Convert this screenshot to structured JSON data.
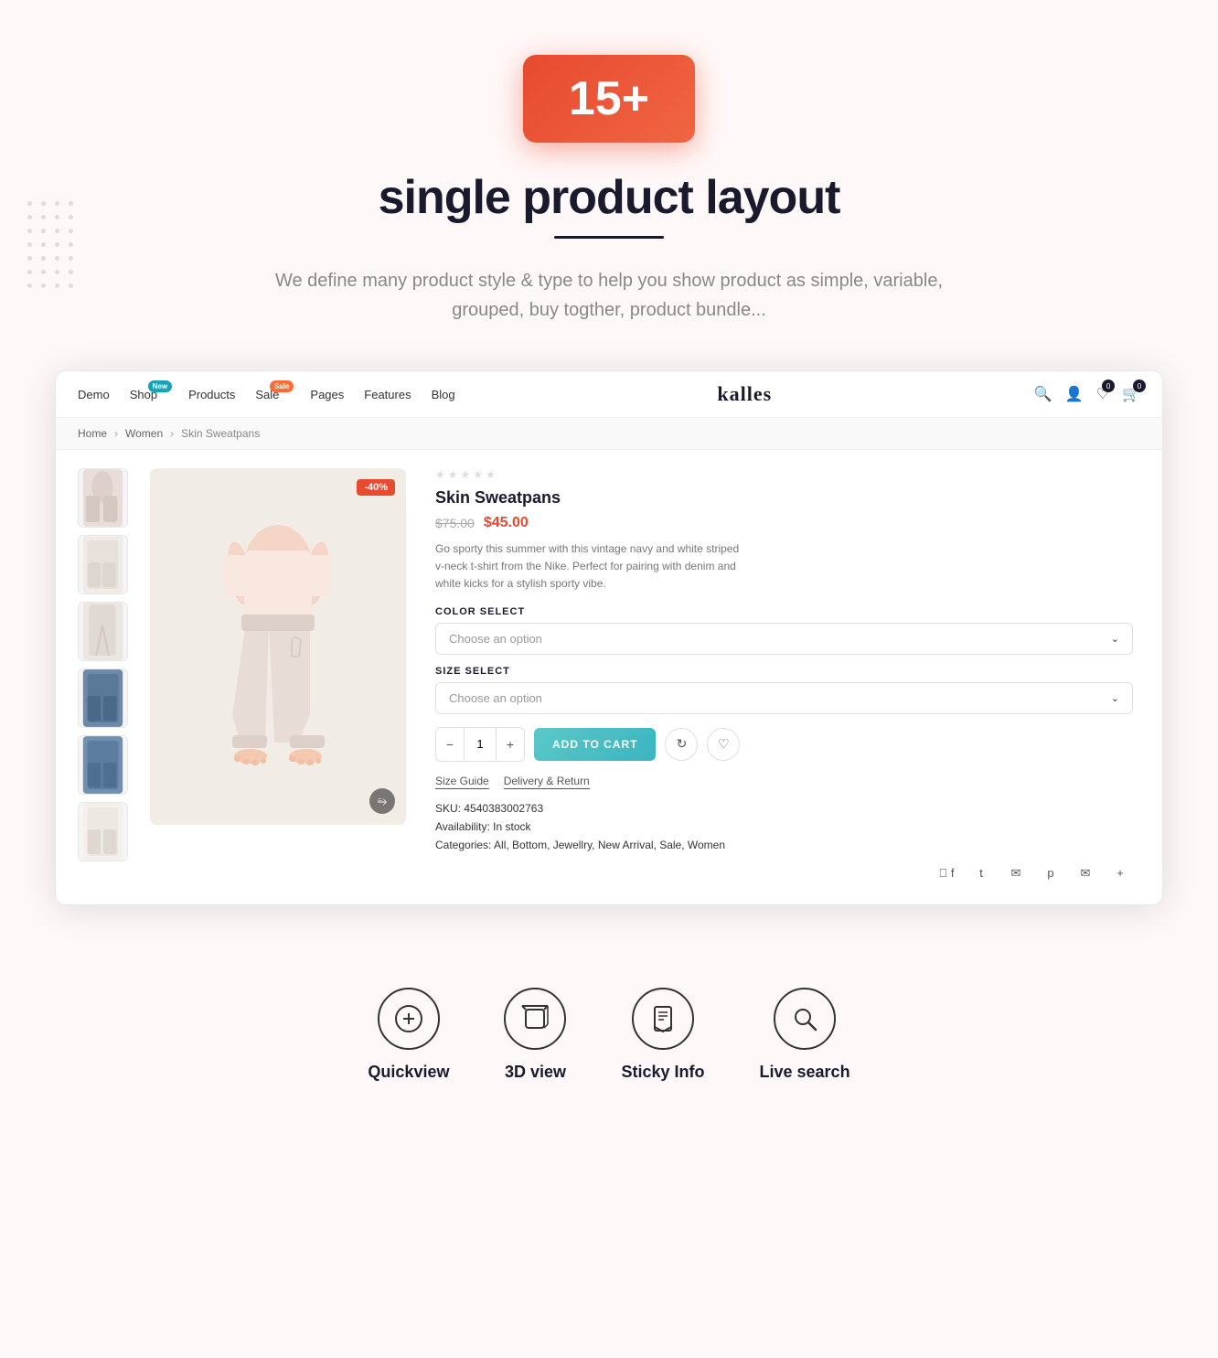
{
  "hero": {
    "badge": "15+",
    "title": "single product layout",
    "description": "We define many product style & type to help you show product as simple, variable, grouped, buy togther, product bundle..."
  },
  "nav": {
    "items": [
      {
        "label": "Demo",
        "badge": null
      },
      {
        "label": "Shop",
        "badge": "New"
      },
      {
        "label": "Products",
        "badge": null
      },
      {
        "label": "Sale",
        "badge": "Sale"
      },
      {
        "label": "Pages",
        "badge": null
      },
      {
        "label": "Features",
        "badge": null
      },
      {
        "label": "Blog",
        "badge": null
      }
    ],
    "logo": "kalles",
    "cart_count": "0",
    "wishlist_count": "0"
  },
  "breadcrumb": {
    "home": "Home",
    "category": "Women",
    "current": "Skin Sweatpans"
  },
  "product": {
    "title": "Skin Sweatpans",
    "price_old": "$75.00",
    "price_new": "$45.00",
    "discount": "-40%",
    "description": "Go sporty this summer with this vintage navy and white striped v-neck t-shirt from the Nike. Perfect for pairing with denim and white kicks for a stylish sporty vibe.",
    "color_label": "COLOR SELECT",
    "color_placeholder": "Choose an option",
    "size_label": "SIZE SELECT",
    "size_placeholder": "Choose an option",
    "qty": "1",
    "add_to_cart": "ADD TO CART",
    "size_guide": "Size Guide",
    "delivery": "Delivery & Return",
    "sku_label": "SKU:",
    "sku_value": "4540383002763",
    "availability_label": "Availability:",
    "availability_value": "In stock",
    "categories_label": "Categories:",
    "categories_value": "All, Bottom, Jewellry, New Arrival, Sale, Women"
  },
  "features": [
    {
      "icon": "➕",
      "label": "Quickview"
    },
    {
      "icon": "📦",
      "label": "3D view"
    },
    {
      "icon": "🔖",
      "label": "Sticky Info"
    },
    {
      "icon": "🔍",
      "label": "Live search"
    }
  ]
}
